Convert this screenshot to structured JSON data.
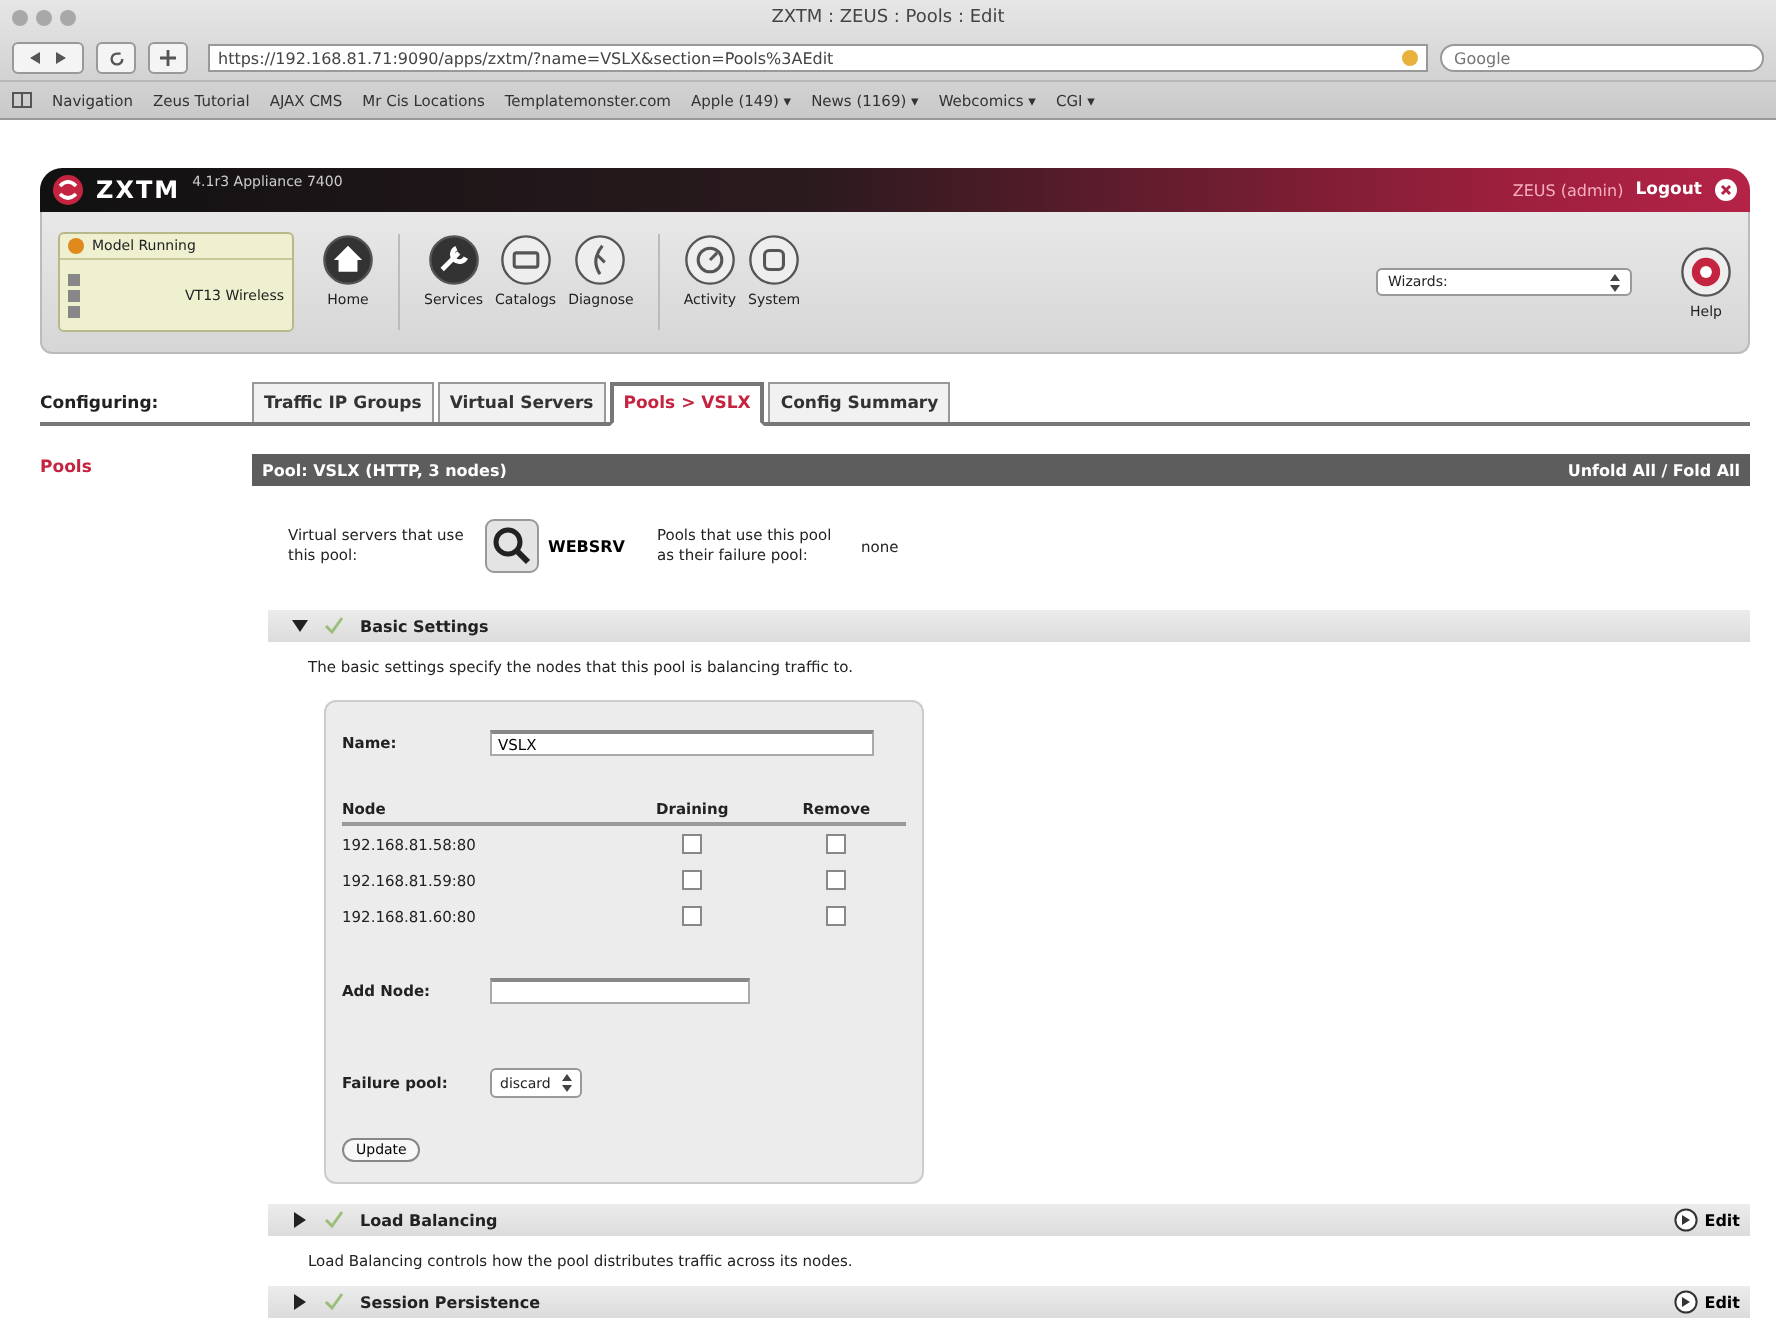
{
  "window": {
    "title": "ZXTM : ZEUS : Pools : Edit"
  },
  "browser": {
    "url": "https://192.168.81.71:9090/apps/zxtm/?name=VSLX&section=Pools%3AEdit",
    "search_placeholder": "Google",
    "bookmarks": [
      "Navigation",
      "Zeus Tutorial",
      "AJAX CMS",
      "Mr Cis Locations",
      "Templatemonster.com",
      "Apple (149) ▾",
      "News (1169) ▾",
      "Webcomics ▾",
      "CGI ▾"
    ]
  },
  "app": {
    "logo": "ZXTM",
    "version": "4.1r3 Appliance 7400",
    "user": "ZEUS (admin)",
    "logout": "Logout"
  },
  "status": {
    "label": "Model Running",
    "traffic": "VT13 Wireless"
  },
  "toolbar": [
    {
      "label": "Home"
    },
    {
      "label": "Services"
    },
    {
      "label": "Catalogs"
    },
    {
      "label": "Diagnose"
    },
    {
      "label": "Activity"
    },
    {
      "label": "System"
    }
  ],
  "wizards": {
    "value": "Wizards:"
  },
  "help": "Help",
  "nav": {
    "label": "Configuring:",
    "tabs": [
      {
        "label": "Traffic IP Groups",
        "selected": false
      },
      {
        "label": "Virtual Servers",
        "selected": false
      },
      {
        "label": "Pools > VSLX",
        "selected": true
      },
      {
        "label": "Config Summary",
        "selected": false
      }
    ]
  },
  "sidebar": {
    "items": [
      {
        "label": "Pools",
        "selected": true
      }
    ]
  },
  "pool": {
    "title": "Pool: VSLX (HTTP, 3 nodes)",
    "fold": "Unfold All / Fold All",
    "vs_label": "Virtual servers that use this pool:",
    "vs": "WEBSRV",
    "failure_label": "Pools that use this pool as their failure pool:",
    "failure_value": "none"
  },
  "sections": [
    {
      "title": "Basic Settings",
      "expanded": true,
      "description": "The basic settings specify the nodes that this pool is balancing traffic to."
    },
    {
      "title": "Load Balancing",
      "expanded": false,
      "description": "Load Balancing controls how the pool distributes traffic across its nodes.",
      "edit": "Edit"
    },
    {
      "title": "Session Persistence",
      "expanded": false,
      "edit": "Edit"
    }
  ],
  "basic": {
    "name_label": "Name:",
    "name": "VSLX",
    "columns": [
      "Node",
      "Draining",
      "Remove"
    ],
    "nodes": [
      {
        "address": "192.168.81.58:80",
        "draining": false,
        "remove": false
      },
      {
        "address": "192.168.81.59:80",
        "draining": false,
        "remove": false
      },
      {
        "address": "192.168.81.60:80",
        "draining": false,
        "remove": false
      }
    ],
    "add_label": "Add Node:",
    "failure_label": "Failure pool:",
    "failure_value": "discard",
    "update": "Update"
  }
}
